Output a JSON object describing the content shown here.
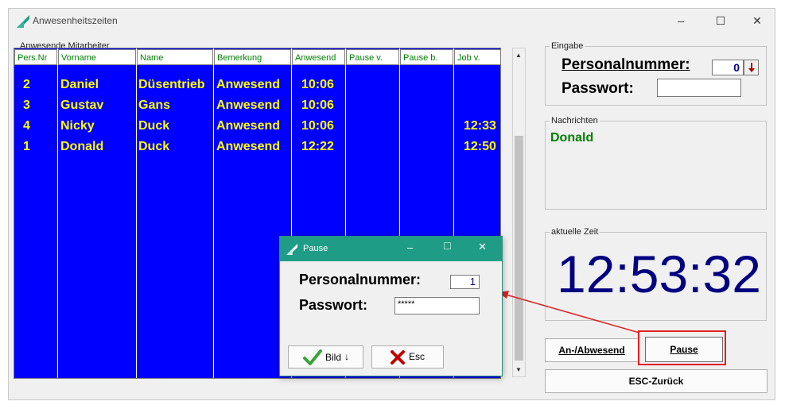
{
  "window": {
    "title": "Anwesenheitszeiten",
    "controls": [
      "–",
      "☐",
      "✕"
    ]
  },
  "employees_group": {
    "legend": "Anwesende Mitarbeiter",
    "columns": [
      "Pers.Nr",
      "Vorname",
      "Name",
      "Bemerkung",
      "Anwesend",
      "Pause v.",
      "Pause b.",
      "Job v."
    ],
    "rows": [
      {
        "nr": "2",
        "vorname": "Daniel",
        "name": "Düsentrieb",
        "bemerkung": "Anwesend",
        "anwesend": "10:06",
        "pause_v": "",
        "pause_b": "",
        "job_v": ""
      },
      {
        "nr": "3",
        "vorname": "Gustav",
        "name": "Gans",
        "bemerkung": "Anwesend",
        "anwesend": "10:06",
        "pause_v": "",
        "pause_b": "",
        "job_v": ""
      },
      {
        "nr": "4",
        "vorname": "Nicky",
        "name": "Duck",
        "bemerkung": "Anwesend",
        "anwesend": "10:06",
        "pause_v": "",
        "pause_b": "",
        "job_v": "12:33"
      },
      {
        "nr": "1",
        "vorname": "Donald",
        "name": "Duck",
        "bemerkung": "Anwesend",
        "anwesend": "12:22",
        "pause_v": "",
        "pause_b": "",
        "job_v": "12:50"
      }
    ]
  },
  "eingabe": {
    "legend": "Eingabe",
    "personalnummer_label": "Personalnummer:",
    "personalnummer_value": "0",
    "passwort_label": "Passwort:",
    "passwort_value": ""
  },
  "nachrichten": {
    "legend": "Nachrichten",
    "message": "Donald"
  },
  "zeit": {
    "legend": "aktuelle Zeit",
    "time": "12:53:32"
  },
  "buttons": {
    "an_abwesend": "An-/Abwesend",
    "pause": "Pause",
    "esc_zurueck": "ESC-Zurück"
  },
  "dialog": {
    "title": "Pause",
    "personalnummer_label": "Personalnummer:",
    "personalnummer_value": "1",
    "passwort_label": "Passwort:",
    "passwort_value": "*****",
    "bild_label": "Bild",
    "esc_label": "Esc"
  },
  "colors": {
    "grid_bg": "#0000ff",
    "grid_text": "#ffff00",
    "header_text": "#008000",
    "message": "#008000",
    "time": "#000080",
    "dialog_title": "#1f9c86",
    "highlight": "#e02020"
  }
}
